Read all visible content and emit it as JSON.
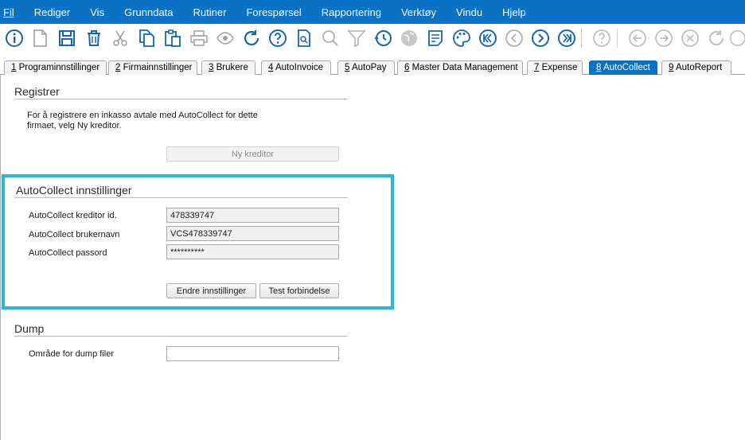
{
  "menubar": {
    "items": [
      "Fil",
      "Rediger",
      "Vis",
      "Grunndata",
      "Rutiner",
      "Forespørsel",
      "Rapportering",
      "Verktøy",
      "Vindu",
      "Hjelp"
    ]
  },
  "toolbar": {
    "icons": [
      "info-icon",
      "new-document-icon",
      "save-icon",
      "delete-icon",
      "cut-icon",
      "copy-icon",
      "paste-icon",
      "print-icon",
      "preview-icon",
      "refresh-icon",
      "help-icon",
      "search-document-icon",
      "search-icon",
      "filter-icon",
      "history-icon",
      "globe-icon",
      "notes-icon",
      "palette-icon",
      "first-record-icon",
      "previous-record-icon",
      "next-record-icon",
      "last-record-icon",
      "help-disabled-icon",
      "back-icon",
      "forward-icon",
      "cancel-icon",
      "reload-icon"
    ]
  },
  "tabs": [
    {
      "num": "1",
      "label": " Programinnstillinger"
    },
    {
      "num": "2",
      "label": " Firmainnstillinger"
    },
    {
      "num": "3",
      "label": " Brukere"
    },
    {
      "num": "4",
      "label": " AutoInvoice"
    },
    {
      "num": "5",
      "label": " AutoPay"
    },
    {
      "num": "6",
      "label": " Master Data Management"
    },
    {
      "num": "7",
      "label": " Expense"
    },
    {
      "num": "8",
      "label": " AutoCollect"
    },
    {
      "num": "9",
      "label": " AutoReport"
    }
  ],
  "registrer": {
    "title": "Registrer",
    "description_line1": "For å registrere en inkasso avtale med AutoCollect for dette",
    "description_line2": "firmaet, velg Ny kreditor.",
    "new_creditor_button": "Ny kreditor"
  },
  "settings": {
    "title": "AutoCollect innstillinger",
    "creditor_id_label": "AutoCollect kreditor id.",
    "creditor_id_value": "478339747",
    "username_label": "AutoCollect brukernavn",
    "username_value": "VCS478339747",
    "password_label": "AutoCollect passord",
    "password_value": "**********",
    "change_button": "Endre  innstillinger",
    "test_button": "Test forbindelse"
  },
  "dump": {
    "title": "Dump",
    "area_label": "Område for dump filer",
    "area_value": ""
  },
  "colors": {
    "menubar": "#0a72c4",
    "active_tab": "#0a72c4",
    "highlight": "#2bb8cf",
    "icon_blue": "#1565b0"
  }
}
